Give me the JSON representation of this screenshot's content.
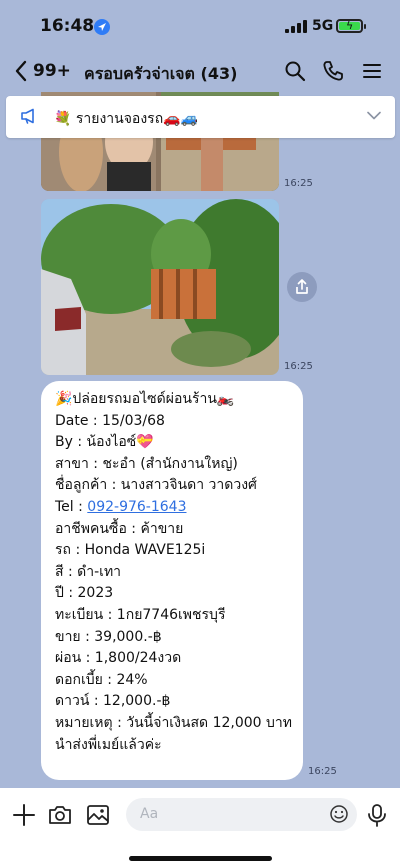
{
  "status_bar": {
    "time": "16:48",
    "network": "5G"
  },
  "header": {
    "unread_count": "99+",
    "title": "ครอบครัวจ่าเจต (43)"
  },
  "announcement": {
    "text": "💐 รายงานจองรถ🚗🚙"
  },
  "messages": {
    "photo1_time": "16:25",
    "photo2_time": "16:25",
    "text_time": "16:25",
    "lines": [
      "🎉ปล่อยรถมอไซด์ผ่อนร้าน🏍️",
      "Date : 15/03/68",
      "By : น้องไอซ์💝",
      "สาขา : ชะอำ (สำนักงานใหญ่)",
      "ชื่อลูกค้า : นางสาวจินดา วาดวงศ์",
      "Tel : ",
      "อาชีพคนซื้อ : ค้าขาย",
      "รถ : Honda WAVE125i",
      "สี : ดำ-เทา",
      "ปี : 2023",
      "ทะเบียน : 1กย7746เพชรบุรี",
      "ขาย : 39,000.-฿",
      "ผ่อน : 1,800/24งวด",
      "ดอกเบี้ย : 24%",
      "ดาวน์ : 12,000.-฿",
      "หมายเหตุ : วันนี้จ่าเงินสด 12,000 บาท",
      "นำส่งพี่เมย์แล้วค่ะ"
    ],
    "phone_link": "092-976-1643"
  },
  "composer": {
    "placeholder": "Aa"
  },
  "icons": {
    "back": "chevron-left-icon",
    "search": "search-icon",
    "call": "phone-icon",
    "menu": "menu-icon",
    "announcement": "megaphone-icon",
    "expand": "chevron-down-icon",
    "share": "share-icon",
    "add": "plus-icon",
    "camera": "camera-icon",
    "gallery": "image-icon",
    "emoji": "emoji-icon",
    "mic": "microphone-icon"
  },
  "colors": {
    "chat_background": "#a9b8d8",
    "link": "#2f6fe0",
    "battery": "#3ad94c"
  }
}
